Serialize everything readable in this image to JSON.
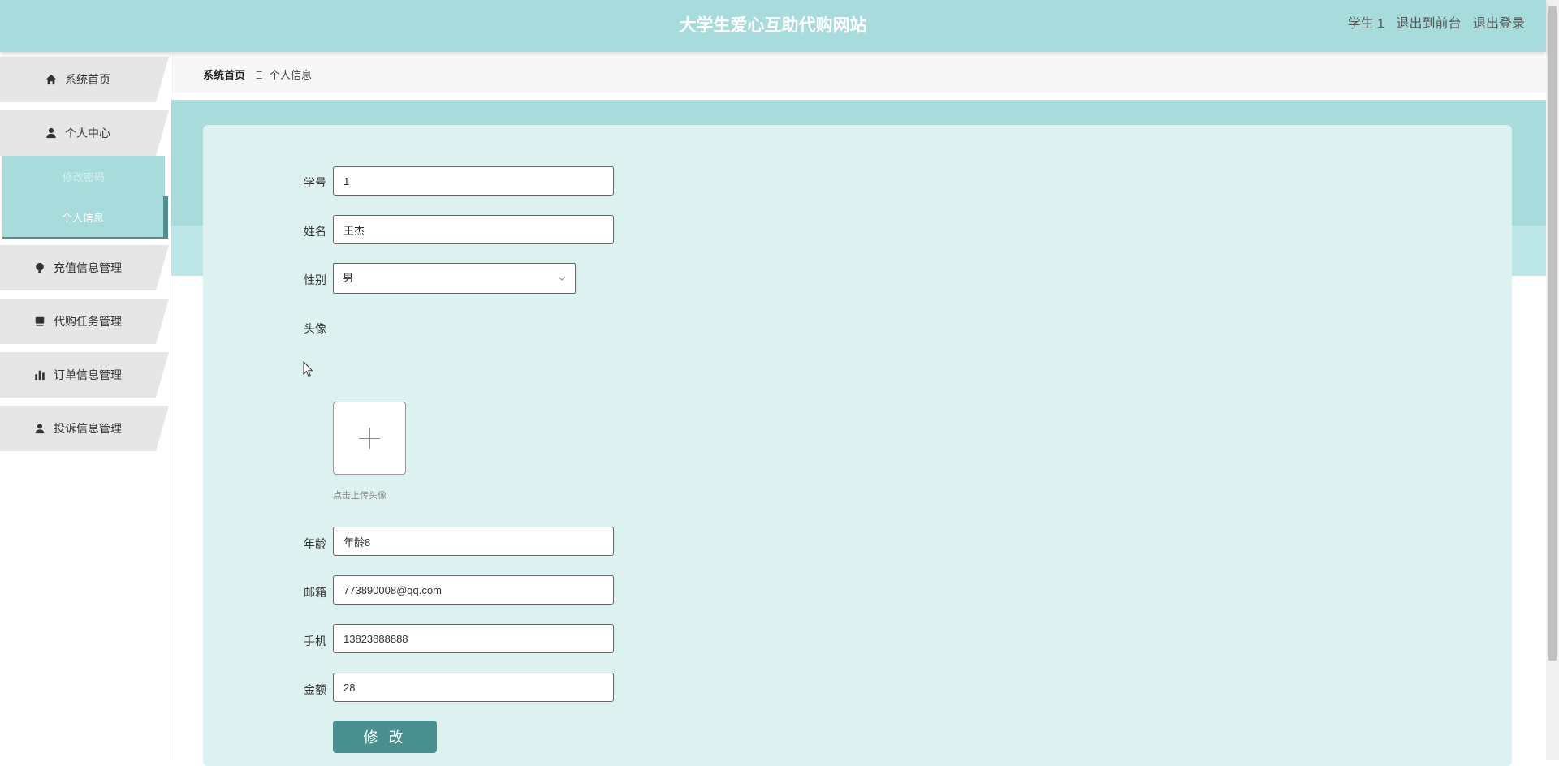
{
  "header": {
    "title": "大学生爱心互助代购网站",
    "user": "学生 1",
    "exit_front": "退出到前台",
    "logout": "退出登录"
  },
  "sidebar": {
    "items": [
      {
        "label": "系统首页",
        "icon": "home-icon"
      },
      {
        "label": "个人中心",
        "icon": "user-icon"
      },
      {
        "label": "充值信息管理",
        "icon": "bulb-icon"
      },
      {
        "label": "代购任务管理",
        "icon": "monitor-icon"
      },
      {
        "label": "订单信息管理",
        "icon": "bar-chart-icon"
      },
      {
        "label": "投诉信息管理",
        "icon": "person-icon"
      }
    ],
    "sub_items": [
      {
        "label": "修改密码"
      },
      {
        "label": "个人信息"
      }
    ]
  },
  "breadcrumb": {
    "home": "系统首页",
    "separator": "Ξ",
    "current": "个人信息"
  },
  "form": {
    "student_id": {
      "label": "学号",
      "value": "1"
    },
    "name": {
      "label": "姓名",
      "value": "王杰"
    },
    "gender": {
      "label": "性别",
      "value": "男"
    },
    "avatar": {
      "label": "头像",
      "tip": "点击上传头像"
    },
    "age": {
      "label": "年龄",
      "value": "年龄8"
    },
    "email": {
      "label": "邮箱",
      "value": "773890008@qq.com"
    },
    "phone": {
      "label": "手机",
      "value": "13823888888"
    },
    "balance": {
      "label": "金额",
      "value": "28"
    },
    "submit_label": "修 改"
  },
  "colors": {
    "header_bg": "#a8dcdc",
    "card_bg": "#ddf1f1",
    "button_bg": "#4a8f8f"
  }
}
